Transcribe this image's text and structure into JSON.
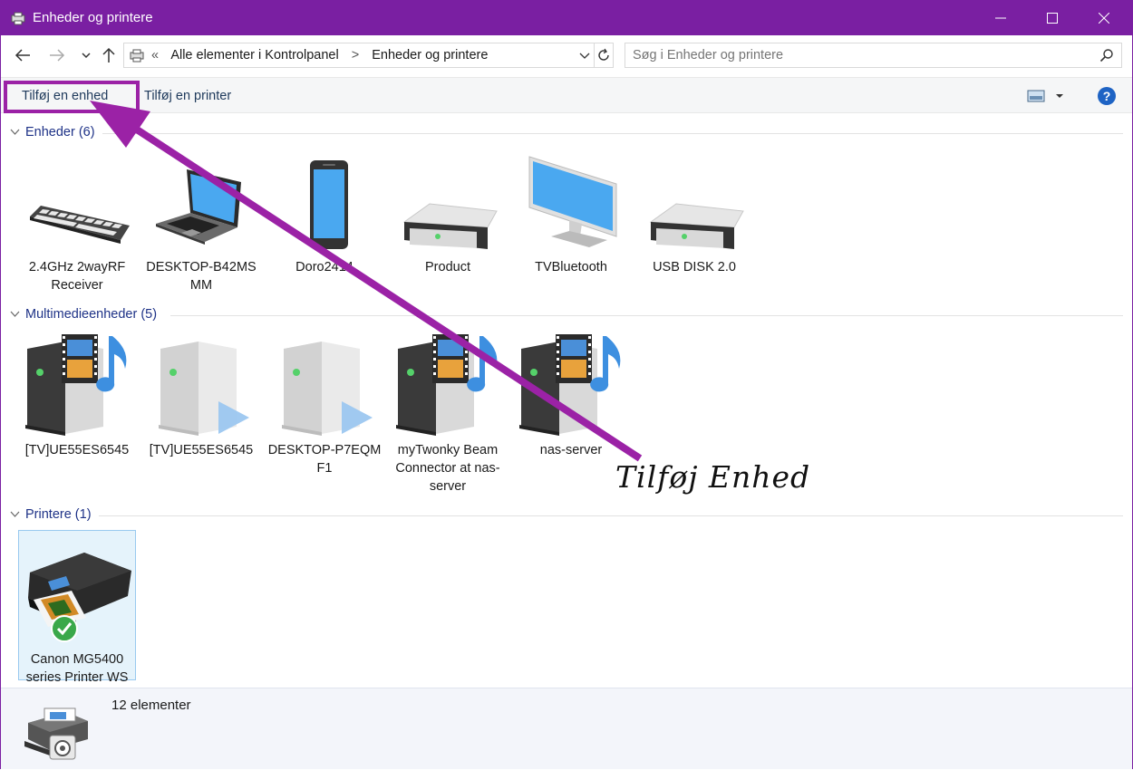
{
  "window": {
    "title": "Enheder og printere",
    "accent_color": "#7a1fa2"
  },
  "nav": {
    "back_icon": "back-arrow-icon",
    "forward_icon": "forward-arrow-icon",
    "recent_icon": "chevron-down-icon",
    "up_icon": "up-arrow-icon",
    "breadcrumb": [
      "«",
      "Alle elementer i Kontrolpanel",
      ">",
      "Enheder og printere"
    ],
    "search_placeholder": "Søg i Enheder og printere"
  },
  "commands": {
    "add_device": "Tilføj en enhed",
    "add_printer": "Tilføj en printer"
  },
  "sections": {
    "devices": {
      "title": "Enheder (6)",
      "items": [
        {
          "label": "2.4GHz 2wayRF Receiver",
          "icon": "keyboard-icon"
        },
        {
          "label": "DESKTOP-B42MS MM",
          "icon": "laptop-icon"
        },
        {
          "label": "Doro2414",
          "icon": "phone-icon"
        },
        {
          "label": "Product",
          "icon": "drive-icon"
        },
        {
          "label": "TVBluetooth",
          "icon": "monitor-icon"
        },
        {
          "label": "USB DISK 2.0",
          "icon": "drive-icon"
        }
      ]
    },
    "multimedia": {
      "title": "Multimedieenheder (5)",
      "items": [
        {
          "label": "[TV]UE55ES6545",
          "icon": "media-server-icon"
        },
        {
          "label": "[TV]UE55ES6545",
          "icon": "media-renderer-icon"
        },
        {
          "label": "DESKTOP-P7EQM F1",
          "icon": "media-renderer-icon"
        },
        {
          "label": "myTwonky Beam Connector at nas-server",
          "icon": "media-server-icon"
        },
        {
          "label": "nas-server",
          "icon": "media-server-icon"
        }
      ]
    },
    "printers": {
      "title": "Printere (1)",
      "items": [
        {
          "label": "Canon MG5400 series Printer WS",
          "icon": "printer-icon"
        }
      ]
    }
  },
  "status": {
    "count": "12 elementer"
  },
  "annotation": {
    "text": "Tilføj Enhed",
    "color": "#9b22a6"
  }
}
